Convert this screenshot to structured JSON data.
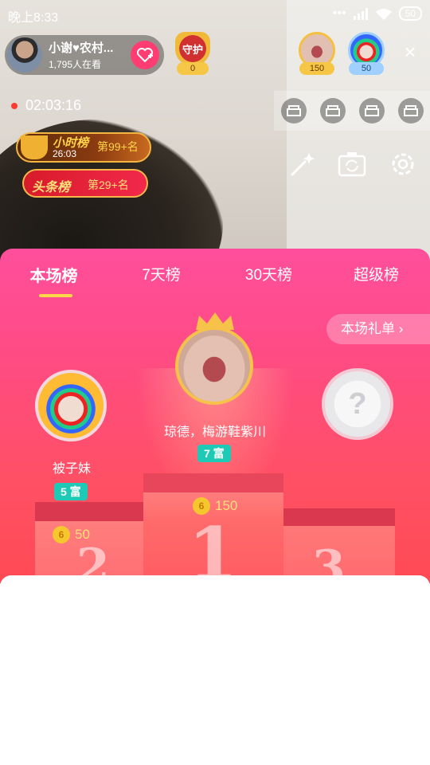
{
  "status_bar": {
    "time": "晚上8:33",
    "battery": "50"
  },
  "host": {
    "name": "小谢♥农村...",
    "viewers": "1,795人在看"
  },
  "guard": {
    "label": "守护",
    "count": "0"
  },
  "top_fans": [
    {
      "value": "150"
    },
    {
      "value": "50"
    }
  ],
  "live_timer": "02:03:16",
  "hour_rank": {
    "title": "小时榜",
    "countdown": "26:03",
    "rank": "第99+名"
  },
  "headline_rank": {
    "title": "头条榜",
    "rank": "第29+名"
  },
  "leaderboard": {
    "tabs": [
      "本场榜",
      "7天榜",
      "30天榜",
      "超级榜"
    ],
    "active_tab": 0,
    "gift_list_label": "本场礼单",
    "first": {
      "name": "琼德，梅游鞋紫川",
      "level": "7 富",
      "coins": "150",
      "place": "1"
    },
    "second": {
      "name": "被子妹",
      "level": "5 富",
      "coins": "50",
      "place": "2"
    },
    "third": {
      "place": "3",
      "placeholder": "?"
    }
  },
  "colors": {
    "accent_pink": "#ff4f9c",
    "podium_red": "#ff5064",
    "gold": "#f6c24a",
    "level_teal": "#1ec9b6"
  }
}
